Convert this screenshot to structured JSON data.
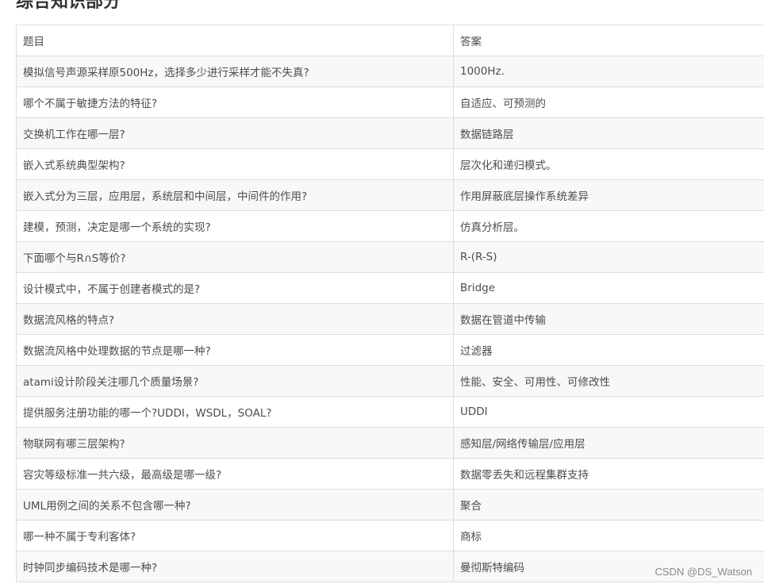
{
  "section": {
    "title": "综合知识部分"
  },
  "table": {
    "headers": [
      "题目",
      "答案"
    ],
    "rows": [
      [
        "模拟信号声源采样原500Hz，选择多少进行采样才能不失真?",
        "1000Hz."
      ],
      [
        "哪个不属于敏捷方法的特征?",
        "自适应、可预测的"
      ],
      [
        "交换机工作在哪一层?",
        "数据链路层"
      ],
      [
        "嵌入式系统典型架构?",
        "层次化和递归模式。"
      ],
      [
        "嵌入式分为三层，应用层，系统层和中间层，中间件的作用?",
        "作用屏蔽底层操作系统差异"
      ],
      [
        "建模，预测，决定是哪一个系统的实现?",
        "仿真分析层。"
      ],
      [
        "下面哪个与R∩S等价?",
        "R-(R-S)"
      ],
      [
        "设计模式中，不属于创建者模式的是?",
        "Bridge"
      ],
      [
        "数据流风格的特点?",
        "数据在管道中传输"
      ],
      [
        "数据流风格中处理数据的节点是哪一种?",
        "过滤器"
      ],
      [
        "atami设计阶段关注哪几个质量场景?",
        "性能、安全、可用性、可修改性"
      ],
      [
        "提供服务注册功能的哪一个?UDDI，WSDL，SOAL?",
        "UDDI"
      ],
      [
        "物联网有哪三层架构?",
        "感知层/网络传输层/应用层"
      ],
      [
        "容灾等级标准一共六级，最高级是哪一级?",
        "数据零丢失和远程集群支持"
      ],
      [
        "UML用例之间的关系不包含哪一种?",
        "聚合"
      ],
      [
        "哪一种不属于专利客体?",
        "商标"
      ],
      [
        "时钟同步编码技术是哪一种?",
        "曼彻斯特编码"
      ]
    ]
  },
  "watermark": {
    "text": "CSDN @DS_Watson"
  }
}
